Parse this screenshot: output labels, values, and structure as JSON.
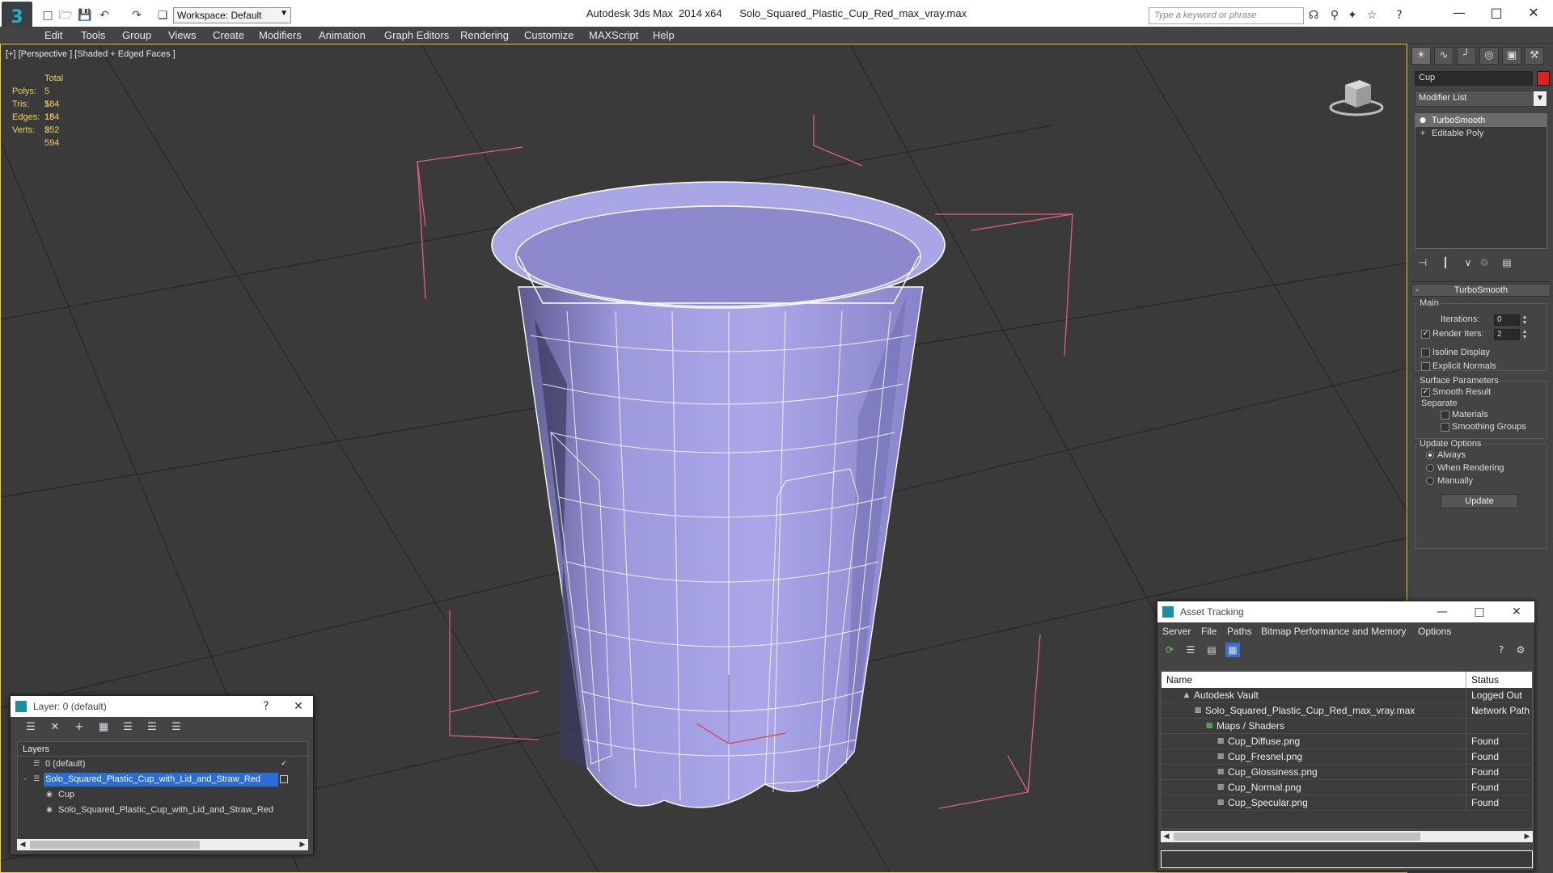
{
  "titlebar": {
    "workspace": "Workspace: Default",
    "title": "Autodesk 3ds Max  2014 x64      Solo_Squared_Plastic_Cup_Red_max_vray.max",
    "search_placeholder": "Type a keyword or phrase"
  },
  "menu": [
    "Edit",
    "Tools",
    "Group",
    "Views",
    "Create",
    "Modifiers",
    "Animation",
    "Graph Editors",
    "Rendering",
    "Customize",
    "MAXScript",
    "Help"
  ],
  "viewport": {
    "label": "[+] [Perspective ] [Shaded + Edged Faces ]",
    "stats_header": "Total",
    "stats": [
      {
        "label": "Polys:",
        "value": "5 184"
      },
      {
        "label": "Tris:",
        "value": "5 184"
      },
      {
        "label": "Edges:",
        "value": "15 552"
      },
      {
        "label": "Verts:",
        "value": "2 594"
      }
    ]
  },
  "command_panel": {
    "object_name": "Cup",
    "object_color": "#e02020",
    "modifier_list": "Modifier List",
    "stack": [
      {
        "label": "TurboSmooth",
        "selected": true,
        "icon": "lightbulb-icon"
      },
      {
        "label": "Editable Poly",
        "selected": false,
        "icon": "plus-box-icon"
      }
    ],
    "rollout": {
      "title": "TurboSmooth",
      "main_group": "Main",
      "iterations_label": "Iterations:",
      "iterations_value": "0",
      "render_iters_label": "Render Iters:",
      "render_iters_value": "2",
      "isoline_label": "Isoline Display",
      "explicit_normals_label": "Explicit Normals",
      "surface_group": "Surface Parameters",
      "smooth_result_label": "Smooth Result",
      "separate_label": "Separate",
      "materials_label": "Materials",
      "smoothing_groups_label": "Smoothing Groups",
      "update_group": "Update Options",
      "always_label": "Always",
      "when_rendering_label": "When Rendering",
      "manually_label": "Manually",
      "update_button": "Update"
    }
  },
  "layer_window": {
    "title": "Layer: 0 (default)",
    "help": "?",
    "column_header": "Layers",
    "rows": [
      {
        "label": "0 (default)",
        "indent": 1,
        "selected": false
      },
      {
        "label": "Solo_Squared_Plastic_Cup_with_Lid_and_Straw_Red",
        "indent": 1,
        "selected": true
      },
      {
        "label": "Cup",
        "indent": 2,
        "selected": false
      },
      {
        "label": "Solo_Squared_Plastic_Cup_with_Lid_and_Straw_Red",
        "indent": 2,
        "selected": false
      }
    ]
  },
  "asset_window": {
    "title": "Asset Tracking",
    "menu": [
      "Server",
      "File",
      "Paths",
      "Bitmap Performance and Memory",
      "Options"
    ],
    "col_name": "Name",
    "col_status": "Status",
    "rows": [
      {
        "name": "Autodesk Vault",
        "status": "Logged Out ...",
        "indent": 1
      },
      {
        "name": "Solo_Squared_Plastic_Cup_Red_max_vray.max",
        "status": "Network Path",
        "indent": 2
      },
      {
        "name": "Maps / Shaders",
        "status": "",
        "indent": 3
      },
      {
        "name": "Cup_Diffuse.png",
        "status": "Found",
        "indent": 4
      },
      {
        "name": "Cup_Fresnel.png",
        "status": "Found",
        "indent": 4
      },
      {
        "name": "Cup_Glossiness.png",
        "status": "Found",
        "indent": 4
      },
      {
        "name": "Cup_Normal.png",
        "status": "Found",
        "indent": 4
      },
      {
        "name": "Cup_Specular.png",
        "status": "Found",
        "indent": 4
      }
    ]
  }
}
